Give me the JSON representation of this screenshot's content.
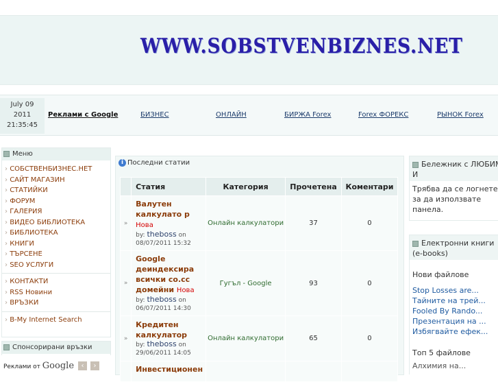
{
  "header": {
    "logo_text": "WWW.SOBSTVENBIZNES.NET"
  },
  "datebox": {
    "date": "July 09",
    "year": "2011",
    "time": "21:35:45"
  },
  "nav": {
    "items": [
      "Реклами с Google",
      "БИЗНЕС",
      "ОНЛАЙН",
      "БИРЖА Forex",
      "Forex ФОРЕКС",
      "РЫНОК Forex"
    ]
  },
  "menu": {
    "title": "Меню",
    "group1": [
      "СОБСТВЕНБИЗНЕС.НЕТ",
      "САЙТ МАГАЗИН",
      "СТАТИЙКИ",
      "ФОРУМ",
      "ГАЛЕРИЯ",
      "ВИДЕО БИБЛИОТЕКА",
      "БИБЛИОТЕКА",
      "КНИГИ",
      "ТЪРСЕНЕ",
      "SEO УСЛУГИ"
    ],
    "group2": [
      "КОНТАКТИ",
      "RSS Новини",
      "ВРЪЗКИ"
    ],
    "group3": [
      "B-My Internet Search"
    ]
  },
  "sponsored": {
    "title": "Спонсорирани връзки",
    "ads_label": "Реклами от",
    "google": "Google"
  },
  "latest": {
    "title": "Последни статии",
    "columns": [
      "Статия",
      "Категория",
      "Прочетена",
      "Коментари"
    ],
    "rows": [
      {
        "title": "Валутен калкулато р",
        "new": "Нова",
        "by": "by:",
        "author": "theboss",
        "on": "on",
        "date": "08/07/2011 15:32",
        "category": "Онлайн калкулатори",
        "views": "37",
        "comments": "0"
      },
      {
        "title": "Google деиндексира всички co.cc домейни",
        "new": "Нова",
        "by": "by:",
        "author": "theboss",
        "on": "on",
        "date": "06/07/2011 14:30",
        "category": "Гугъл - Google",
        "views": "93",
        "comments": "0"
      },
      {
        "title": "Кредитен калкулатор",
        "new": "",
        "by": "by:",
        "author": "theboss",
        "on": "on",
        "date": "29/06/2011 14:05",
        "category": "Онлайн калкулатори",
        "views": "65",
        "comments": "0"
      },
      {
        "title": "Инвестиционен",
        "new": "",
        "by": "",
        "author": "",
        "on": "",
        "date": "",
        "category": "",
        "views": "",
        "comments": ""
      }
    ]
  },
  "notebook": {
    "title": "Бележник с ЛЮБИМИ",
    "title2": "И",
    "text": [
      "Трябва да се логнете",
      "за да използвате",
      "панела."
    ]
  },
  "ebooks": {
    "title": "Електронни книги",
    "title2": "(e-books)",
    "new_files": "Нови файлове",
    "files": [
      "Stop Losses are...",
      "Тайните на трей...",
      "Fooled By Rando...",
      "Презентация на ...",
      "Избягвайте ефек..."
    ],
    "top5": "Топ 5 файлове",
    "top_first": "Алхимия на..."
  },
  "colors": {
    "accent_link": "#8b3c0a",
    "logo": "#2a1fa8",
    "new_badge": "#d40000",
    "category": "#2f6b2f"
  }
}
